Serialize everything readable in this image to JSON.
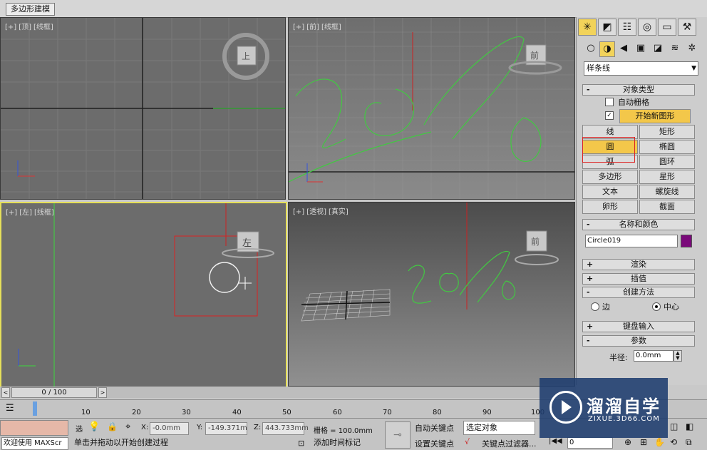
{
  "ribbon": {
    "tab_label": "多边形建模"
  },
  "viewports": {
    "top": {
      "plus": "[+]",
      "view": "[顶]",
      "shading": "[线框]",
      "cube_label": "上"
    },
    "front": {
      "plus": "[+]",
      "view": "[前]",
      "shading": "[线框]",
      "cube_label": "前"
    },
    "left": {
      "plus": "[+]",
      "view": "[左]",
      "shading": "[线框]",
      "cube_label": "左"
    },
    "persp": {
      "plus": "[+]",
      "view": "[透视]",
      "shading": "[真实]",
      "cube_label": "前"
    }
  },
  "command_panel": {
    "tabs": [
      "create-icon",
      "modify-icon",
      "hierarchy-icon",
      "motion-icon",
      "display-icon",
      "utilities-icon"
    ],
    "dropdown_value": "样条线",
    "object_type": {
      "title": "对象类型",
      "auto_grid": "自动栅格",
      "start_new_shape": "开始新图形",
      "buttons": [
        "线",
        "矩形",
        "圆",
        "椭圆",
        "弧",
        "圆环",
        "多边形",
        "星形",
        "文本",
        "螺旋线",
        "卵形",
        "截面"
      ],
      "active_button": "圆"
    },
    "name_color": {
      "title": "名称和颜色",
      "name_value": "Circle019",
      "color": "#7a0a7a"
    },
    "render": "渲染",
    "interpolation": "插值",
    "creation_method": {
      "title": "创建方法",
      "edge": "边",
      "center": "中心",
      "selected": "中心"
    },
    "keyboard_entry": "键盘输入",
    "parameters": {
      "title": "参数",
      "radius_label": "半径:",
      "radius_value": "0.0mm"
    }
  },
  "timeline": {
    "frame": "0 / 100",
    "ticks": [
      "10",
      "20",
      "30",
      "40",
      "50",
      "60",
      "70",
      "80",
      "90",
      "100"
    ]
  },
  "status": {
    "welcome": "欢迎使用 MAXScr",
    "prompt": "单击并拖动以开始创建过程",
    "x_label": "X:",
    "x_value": "-0.0mm",
    "y_label": "Y:",
    "y_value": "-149.371m",
    "z_label": "Z:",
    "z_value": "443.733mm",
    "grid": "栅格 = 100.0mm",
    "add_time_tag": "添加时间标记",
    "auto_key": "自动关键点",
    "set_key": "设置关键点",
    "selected_object": "选定对象",
    "key_filters": "关键点过滤器...",
    "frame_field": "0"
  },
  "watermark": {
    "title": "溜溜自学",
    "url": "ZIXUE.3D66.COM"
  }
}
